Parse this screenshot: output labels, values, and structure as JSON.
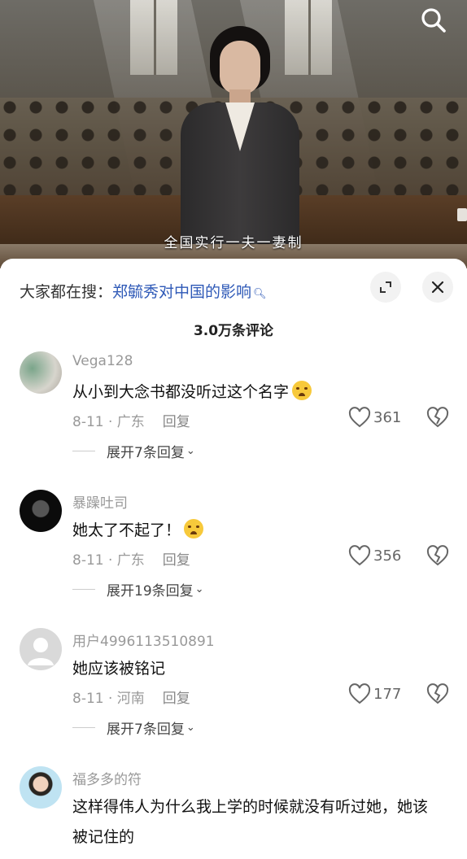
{
  "video": {
    "subtitle": "全国实行一夫一妻制"
  },
  "comments_panel": {
    "hot_search_prefix": "大家都在搜：",
    "hot_search_keyword": "郑毓秀对中国的影响",
    "comment_count": "3.0万条评论",
    "comments": [
      {
        "username": "Vega128",
        "text": "从小到大念书都没听过这个名字",
        "emoji": "crying-emoji",
        "date_location": "8-11 · 广东",
        "reply_label": "回复",
        "likes": "361",
        "expand_label": "展开7条回复"
      },
      {
        "username": "暴躁吐司",
        "text": "她太了不起了！",
        "emoji": "teary-emoji",
        "date_location": "8-11 · 广东",
        "reply_label": "回复",
        "likes": "356",
        "expand_label": "展开19条回复"
      },
      {
        "username": "用户4996113510891",
        "text": "她应该被铭记",
        "date_location": "8-11 · 河南",
        "reply_label": "回复",
        "likes": "177",
        "expand_label": "展开7条回复"
      },
      {
        "username": "福多多的符",
        "text": "这样得伟人为什么我上学的时候就没有听过她，她该被记住的"
      }
    ]
  },
  "colors": {
    "keyword": "#2e59b7",
    "muted": "#999999",
    "text": "#111111"
  }
}
